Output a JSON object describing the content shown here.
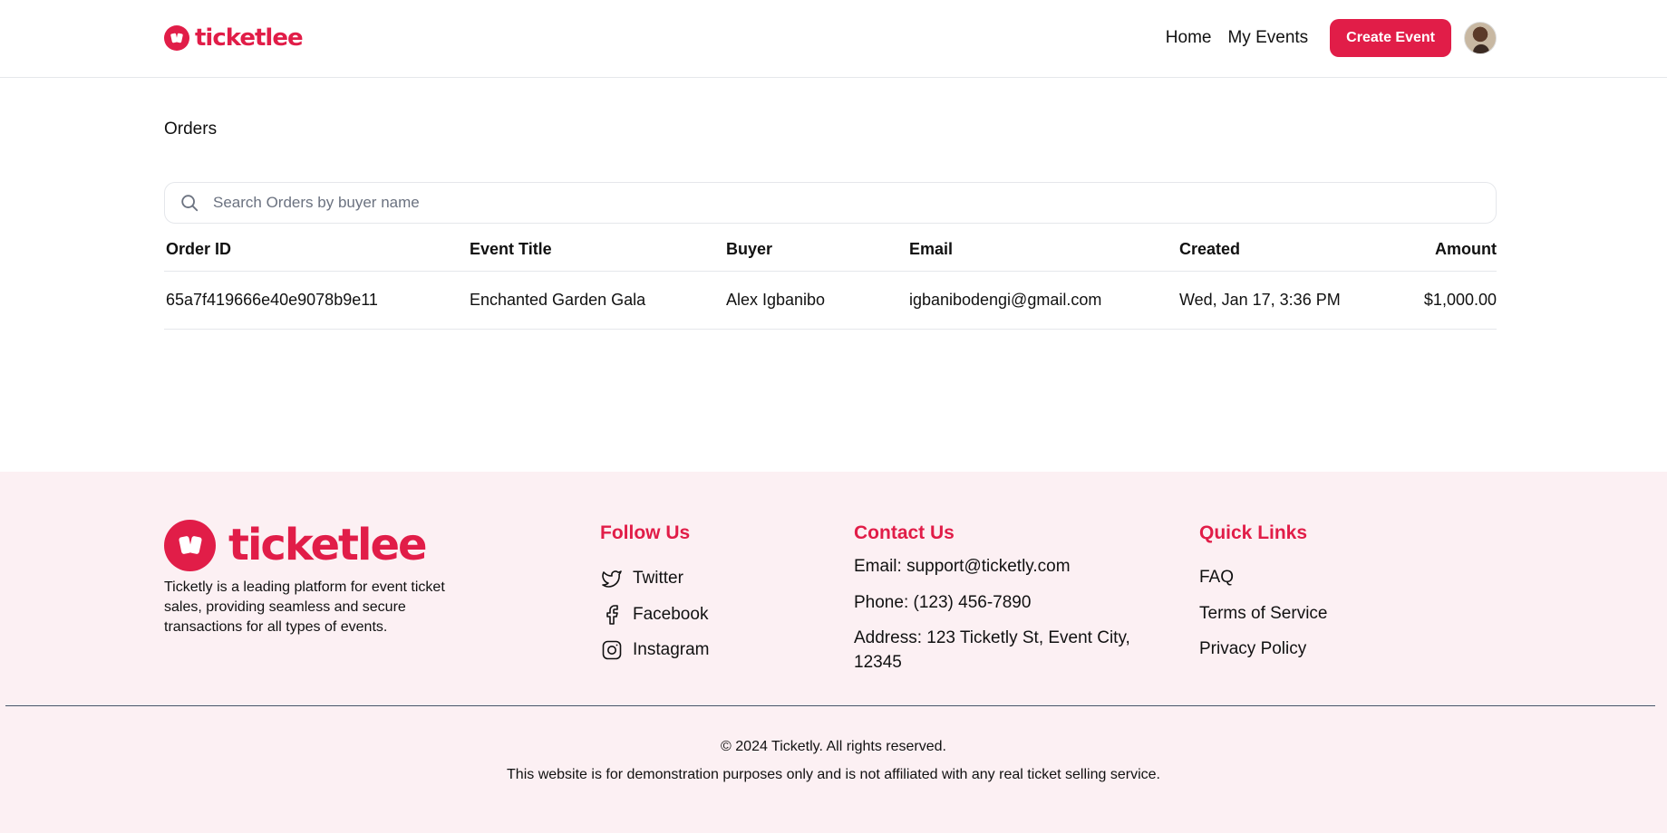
{
  "brand": {
    "name": "ticketlee",
    "accent": "#e11d48"
  },
  "nav": {
    "home": "Home",
    "my_events": "My Events",
    "create_event": "Create Event"
  },
  "page": {
    "title": "Orders"
  },
  "search": {
    "placeholder": "Search Orders by buyer name",
    "value": ""
  },
  "table": {
    "headers": [
      "Order ID",
      "Event Title",
      "Buyer",
      "Email",
      "Created",
      "Amount"
    ],
    "rows": [
      [
        "65a7f419666e40e9078b9e11",
        "Enchanted Garden Gala",
        "Alex Igbanibo",
        "igbanibodengi@gmail.com",
        "Wed, Jan 17, 3:36 PM",
        "$1,000.00"
      ]
    ]
  },
  "footer": {
    "description": "Ticketly is a leading platform for event ticket sales, providing seamless and secure transactions for all types of events.",
    "follow_heading": "Follow Us",
    "social": [
      {
        "label": "Twitter",
        "icon": "twitter-icon"
      },
      {
        "label": "Facebook",
        "icon": "facebook-icon"
      },
      {
        "label": "Instagram",
        "icon": "instagram-icon"
      }
    ],
    "contact_heading": "Contact Us",
    "contact_email": "Email: support@ticketly.com",
    "contact_phone": "Phone: (123) 456-7890",
    "contact_address": "Address: 123 Ticketly St, Event City, 12345",
    "links_heading": "Quick Links",
    "links": [
      "FAQ",
      "Terms of Service",
      "Privacy Policy"
    ],
    "copyright": "© 2024 Ticketly. All rights reserved.",
    "disclaimer": "This website is for demonstration purposes only and is not affiliated with any real ticket selling service."
  }
}
